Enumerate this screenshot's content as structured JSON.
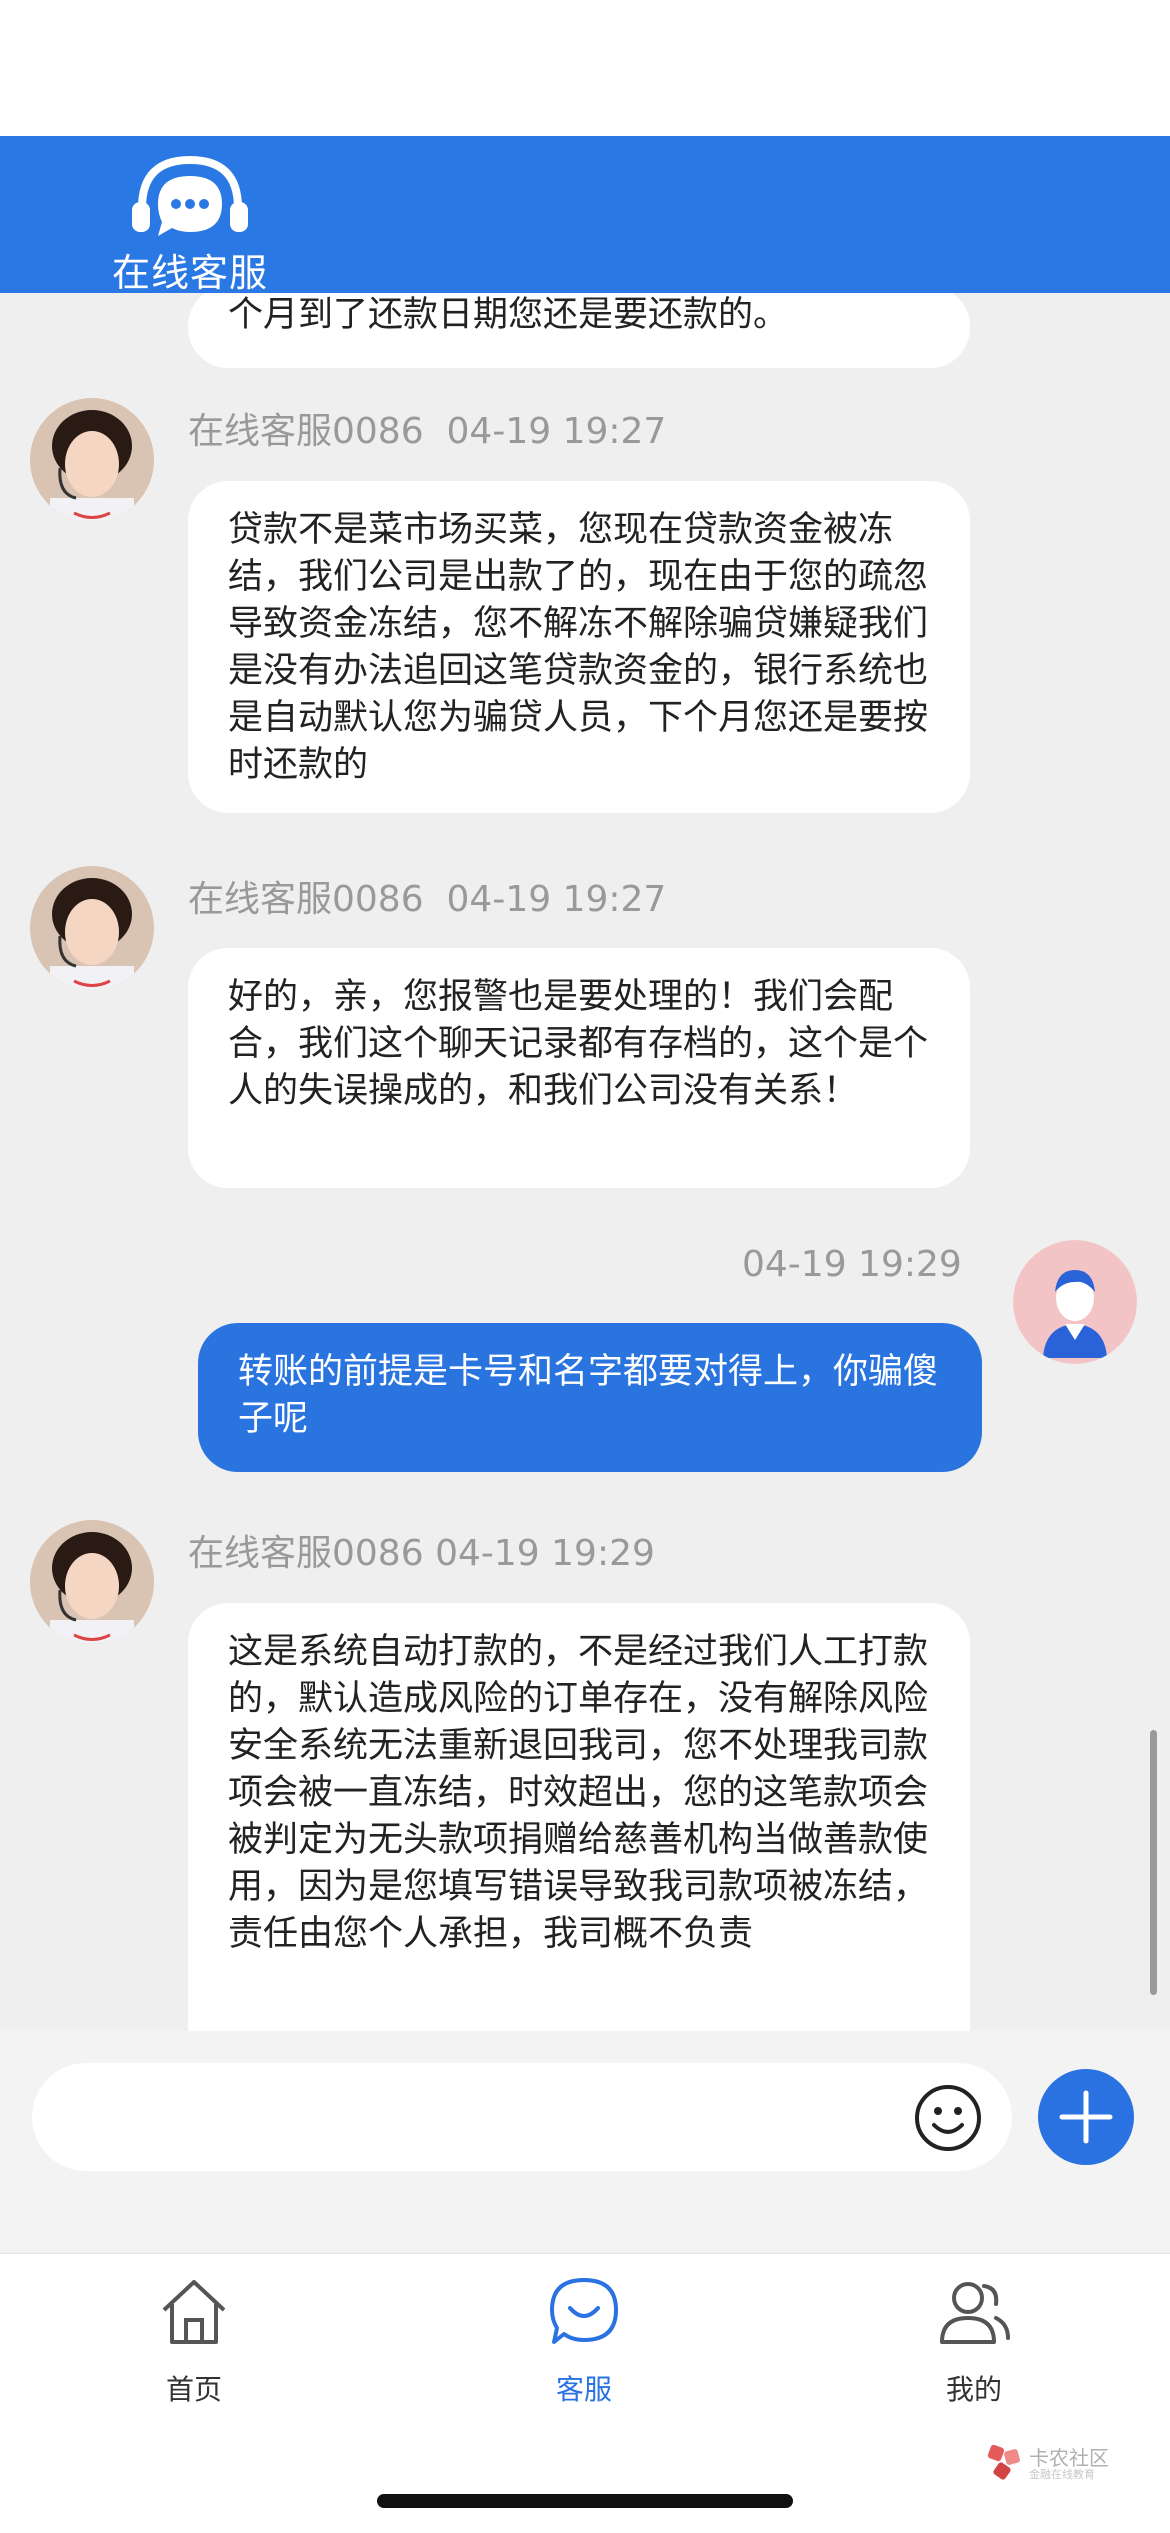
{
  "header": {
    "title": "在线客服"
  },
  "messages": [
    {
      "side": "agent",
      "sender": "",
      "time": "",
      "text": "个月到了还款日期您还是要还款的。"
    },
    {
      "side": "agent",
      "sender": "在线客服0086",
      "time": "04-19 19:27",
      "text": "贷款不是菜市场买菜，您现在贷款资金被冻结，我们公司是出款了的，现在由于您的疏忽导致资金冻结，您不解冻不解除骗贷嫌疑我们是没有办法追回这笔贷款资金的，银行系统也是自动默认您为骗贷人员，下个月您还是要按时还款的"
    },
    {
      "side": "agent",
      "sender": "在线客服0086",
      "time": "04-19 19:27",
      "text": "好的，亲，您报警也是要处理的！我们会配合，我们这个聊天记录都有存档的，这个是个人的失误操成的，和我们公司没有关系！"
    },
    {
      "side": "self",
      "sender": "",
      "time": "04-19 19:29",
      "text": "转账的前提是卡号和名字都要对得上，你骗傻子呢"
    },
    {
      "side": "agent",
      "sender": "在线客服0086",
      "time": "04-19 19:29",
      "text": "这是系统自动打款的，不是经过我们人工打款的，默认造成风险的订单存在，没有解除风险安全系统无法重新退回我司，您不处理我司款项会被一直冻结，时效超出，您的这笔款项会被判定为无头款项捐赠给慈善机构当做善款使用，因为是您填写错误导致我司款项被冻结，责任由您个人承担，我司概不负责"
    }
  ],
  "input": {
    "placeholder": ""
  },
  "tabs": [
    {
      "label": "首页",
      "icon": "home-icon",
      "active": false
    },
    {
      "label": "客服",
      "icon": "chat-icon",
      "active": true
    },
    {
      "label": "我的",
      "icon": "users-icon",
      "active": false
    }
  ],
  "watermark": {
    "brand": "卡农社区",
    "sub": "金融在线教育"
  },
  "colors": {
    "accent": "#2a78e4",
    "self_bubble": "#2a74e0",
    "background": "#efefef"
  }
}
